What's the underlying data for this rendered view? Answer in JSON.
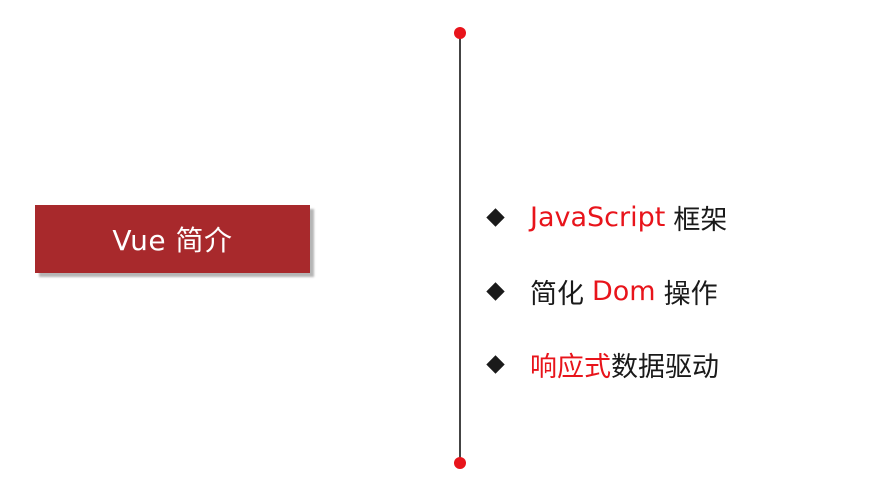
{
  "title": "Vue 简介",
  "colors": {
    "accent_red": "#e8141b",
    "title_box": "#a8292c",
    "text": "#1a1a1a"
  },
  "bullet_icon": "diamond-icon",
  "bullets": [
    {
      "highlight": "JavaScript",
      "rest": "框架"
    },
    {
      "lead": "简化",
      "highlight": "Dom",
      "rest": "操作"
    },
    {
      "highlight": "响应式",
      "rest": "数据驱动"
    }
  ]
}
